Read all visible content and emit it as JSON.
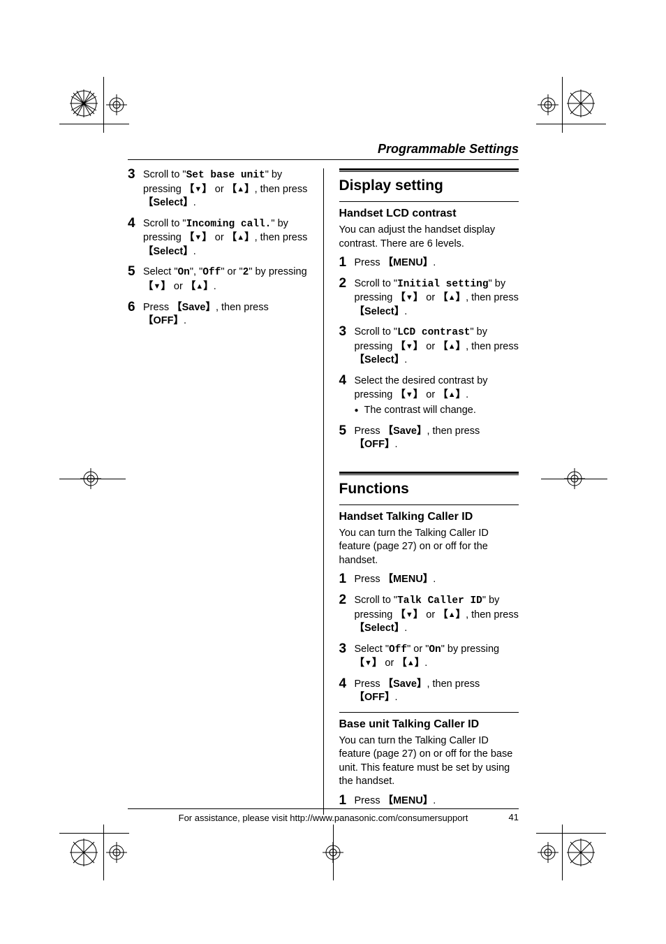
{
  "header": {
    "section": "Programmable Settings"
  },
  "left": {
    "steps": [
      {
        "n": "3",
        "pre": "Scroll to \"",
        "mono": "Set base unit",
        "post": "\" by pressing ",
        "k1": "【",
        "a1": "▼",
        "k1b": "】",
        "or": " or ",
        "k2": "【",
        "a2": "▲",
        "k2b": "】",
        "tail": ", then press ",
        "sel": "【Select】",
        "end": "."
      },
      {
        "n": "4",
        "pre": "Scroll to \"",
        "mono": "Incoming call.",
        "post": "\" by pressing ",
        "k1": "【",
        "a1": "▼",
        "k1b": "】",
        "or": " or ",
        "k2": "【",
        "a2": "▲",
        "k2b": "】",
        "tail": ", then press ",
        "sel": "【Select】",
        "end": "."
      },
      {
        "n": "5",
        "pre": "Select \"",
        "mono": "On",
        "mid1": "\", \"",
        "mono2": "Off",
        "mid2": "\" or \"",
        "mono3": "2",
        "post": "\" by pressing ",
        "k1": "【",
        "a1": "▼",
        "k1b": "】",
        "or": " or ",
        "k2": "【",
        "a2": "▲",
        "k2b": "】",
        "end": "."
      },
      {
        "n": "6",
        "pre": "Press ",
        "sel": "【Save】",
        "mid": ", then press ",
        "sel2": "【OFF】",
        "end": "."
      }
    ]
  },
  "right": {
    "sec1": {
      "title": "Display setting",
      "sub": "Handset LCD contrast",
      "intro": "You can adjust the handset display contrast. There are 6 levels.",
      "steps": [
        {
          "n": "1",
          "pre": "Press ",
          "sel": "【MENU】",
          "end": "."
        },
        {
          "n": "2",
          "pre": "Scroll to \"",
          "mono": "Initial setting",
          "post": "\" by pressing ",
          "k1": "【",
          "a1": "▼",
          "k1b": "】",
          "or": " or ",
          "k2": "【",
          "a2": "▲",
          "k2b": "】",
          "tail": ", then press ",
          "sel": "【Select】",
          "end": "."
        },
        {
          "n": "3",
          "pre": "Scroll to \"",
          "mono": "LCD contrast",
          "post": "\" by pressing ",
          "k1": "【",
          "a1": "▼",
          "k1b": "】",
          "or": " or ",
          "k2": "【",
          "a2": "▲",
          "k2b": "】",
          "tail": ", then press ",
          "sel": "【Select】",
          "end": "."
        },
        {
          "n": "4",
          "pre": "Select the desired contrast by pressing ",
          "k1": "【",
          "a1": "▼",
          "k1b": "】",
          "or": " or ",
          "k2": "【",
          "a2": "▲",
          "k2b": "】",
          "end": ".",
          "bullet": "The contrast will change."
        },
        {
          "n": "5",
          "pre": "Press ",
          "sel": "【Save】",
          "mid": ", then press ",
          "sel2": "【OFF】",
          "end": "."
        }
      ]
    },
    "sec2": {
      "title": "Functions",
      "sub1": {
        "heading": "Handset Talking Caller ID",
        "intro": "You can turn the Talking Caller ID feature (page 27) on or off for the handset.",
        "steps": [
          {
            "n": "1",
            "pre": "Press ",
            "sel": "【MENU】",
            "end": "."
          },
          {
            "n": "2",
            "pre": "Scroll to \"",
            "mono": "Talk Caller ID",
            "post": "\" by pressing ",
            "k1": "【",
            "a1": "▼",
            "k1b": "】",
            "or": " or ",
            "k2": "【",
            "a2": "▲",
            "k2b": "】",
            "tail": ", then press ",
            "sel": "【Select】",
            "end": "."
          },
          {
            "n": "3",
            "pre": "Select \"",
            "mono": "Off",
            "mid1": "\" or \"",
            "mono2": "On",
            "post": "\" by pressing ",
            "k1": "【",
            "a1": "▼",
            "k1b": "】",
            "or": " or ",
            "k2": "【",
            "a2": "▲",
            "k2b": "】",
            "end": "."
          },
          {
            "n": "4",
            "pre": "Press ",
            "sel": "【Save】",
            "mid": ", then press ",
            "sel2": "【OFF】",
            "end": "."
          }
        ]
      },
      "sub2": {
        "heading": "Base unit Talking Caller ID",
        "intro": "You can turn the Talking Caller ID feature (page 27) on or off for the base unit. This feature must be set by using the handset.",
        "steps": [
          {
            "n": "1",
            "pre": "Press ",
            "sel": "【MENU】",
            "end": "."
          }
        ]
      }
    }
  },
  "footer": {
    "text": "For assistance, please visit http://www.panasonic.com/consumersupport",
    "page": "41"
  }
}
